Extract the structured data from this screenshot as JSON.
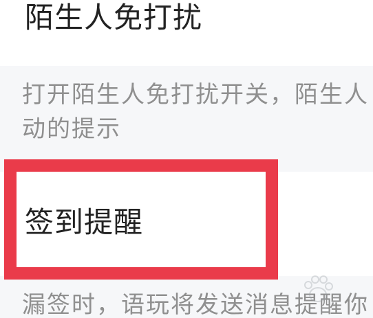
{
  "sections": [
    {
      "title": "陌生人免打扰",
      "description_lines": [
        "打开陌生人免打扰开关，陌生人",
        "动的提示"
      ]
    },
    {
      "title": "签到提醒",
      "description_lines": [
        "漏签时，语玩将发送消息提醒你"
      ]
    }
  ],
  "colors": {
    "highlight": "#ea3b4a",
    "description_bg": "#f6f7f9",
    "description_text": "#8f8f8f",
    "title_text": "#222222"
  },
  "icons": {
    "watermark": "baidu-paw-watermark"
  }
}
